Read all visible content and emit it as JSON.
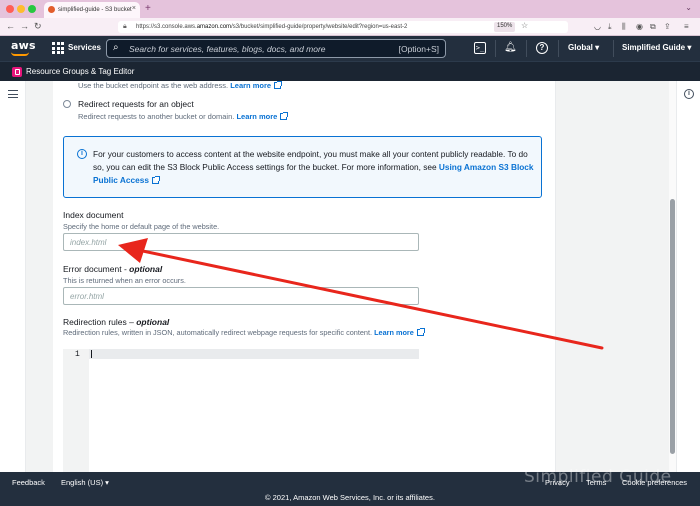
{
  "browser": {
    "tab_title": "simplified-guide - S3 bucket",
    "tab_close": "×",
    "new_tab": "+",
    "nav_back": "←",
    "nav_forward": "→",
    "nav_reload": "↻",
    "url_prefix": "https://s3.console.aws.",
    "url_domain": "amazon.com",
    "url_path": "/s3/bucket/simplified-guide/property/website/edit?region=us-east-2",
    "zoom": "150%",
    "colors": {
      "tabstrip": "#e5c3dc",
      "close": "#ff5f57",
      "minimize": "#febc2e",
      "maximize": "#28c840"
    }
  },
  "aws_nav": {
    "logo": "aws",
    "services_label": "Services",
    "search_placeholder": "Search for services, features, blogs, docs, and more",
    "search_shortcut": "[Option+S]",
    "region_label": "Global ▾",
    "account_label": "Simplified Guide ▾",
    "icons": [
      "cloudshell-icon",
      "bell-icon",
      "help-icon"
    ]
  },
  "favorites_bar": {
    "resource_groups_label": "Resource Groups & Tag Editor"
  },
  "form": {
    "hosting_desc_prefix": "Use the bucket endpoint as the web address.",
    "hosting_learn_more": "Learn more",
    "redirect_option_label": "Redirect requests for an object",
    "redirect_option_desc": "Redirect requests to another bucket or domain.",
    "redirect_learn_more": "Learn more",
    "alert_text": "For your customers to access content at the website endpoint, you must make all your content publicly readable. To do so, you can edit the S3 Block Public Access settings for the bucket. For more information, see ",
    "alert_link": "Using Amazon S3 Block Public Access",
    "index_label": "Index document",
    "index_desc": "Specify the home or default page of the website.",
    "index_placeholder": "index.html",
    "index_value": "",
    "error_label": "Error document - ",
    "error_optional": "optional",
    "error_desc": "This is returned when an error occurs.",
    "error_placeholder": "error.html",
    "error_value": "",
    "redirect_rules_label": "Redirection rules – ",
    "redirect_rules_optional": "optional",
    "redirect_rules_desc": "Redirection rules, written in JSON, automatically redirect webpage requests for specific content.",
    "redirect_rules_learn_more": "Learn more",
    "editor_line_number": "1",
    "annotation_color": "#e8261c"
  },
  "footer": {
    "feedback": "Feedback",
    "language": "English (US) ▾",
    "privacy": "Privacy",
    "terms": "Terms",
    "cookie": "Cookie preferences",
    "copyright": "© 2021, Amazon Web Services, Inc. or its affiliates.",
    "watermark": "Simplified Guide"
  }
}
